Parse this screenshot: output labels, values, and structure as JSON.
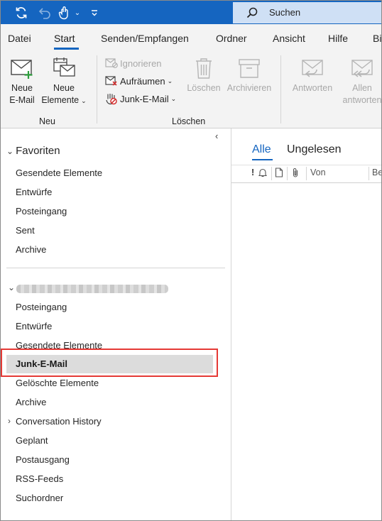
{
  "search": {
    "label": "Suchen",
    "icon": "search-icon"
  },
  "quick_access": [
    "sync-icon",
    "undo-icon",
    "touch-mode-icon",
    "dropdown-icon",
    "customize-toolbar-icon"
  ],
  "tabs": [
    {
      "label": "Datei"
    },
    {
      "label": "Start",
      "active": true
    },
    {
      "label": "Senden/Empfangen"
    },
    {
      "label": "Ordner"
    },
    {
      "label": "Ansicht"
    },
    {
      "label": "Hilfe"
    },
    {
      "label": "Bi"
    }
  ],
  "ribbon": {
    "new_email": {
      "line1": "Neue",
      "line2": "E-Mail"
    },
    "new_items": {
      "line1": "Neue",
      "line2": "Elemente"
    },
    "group_new": "Neu",
    "ignore": "Ignorieren",
    "cleanup": "Aufräumen",
    "junk": "Junk-E-Mail",
    "delete": "Löschen",
    "archive": "Archivieren",
    "group_delete": "Löschen",
    "reply": "Antworten",
    "reply_all": {
      "line1": "Allen",
      "line2": "antworten"
    }
  },
  "folder_pane": {
    "favorites_header": "Favoriten",
    "favorites": [
      "Gesendete Elemente",
      "Entwürfe",
      "Posteingang",
      "Sent",
      "Archive"
    ],
    "account_folders": [
      {
        "label": "Posteingang"
      },
      {
        "label": "Entwürfe"
      },
      {
        "label": "Gesendete Elemente"
      },
      {
        "label": "Junk-E-Mail",
        "selected": true
      },
      {
        "label": "Gelöschte Elemente"
      },
      {
        "label": "Archive"
      },
      {
        "label": "Conversation History",
        "expandable": true
      },
      {
        "label": "Geplant"
      },
      {
        "label": "Postausgang"
      },
      {
        "label": "RSS-Feeds"
      },
      {
        "label": "Suchordner"
      }
    ]
  },
  "message_list": {
    "filter_all": "Alle",
    "filter_unread": "Ungelesen",
    "columns": {
      "importance": "!",
      "from": "Von",
      "subject": "Be"
    }
  },
  "colors": {
    "accent": "#1565c0",
    "highlight": "#e53935",
    "selection": "#dcdcdc"
  }
}
